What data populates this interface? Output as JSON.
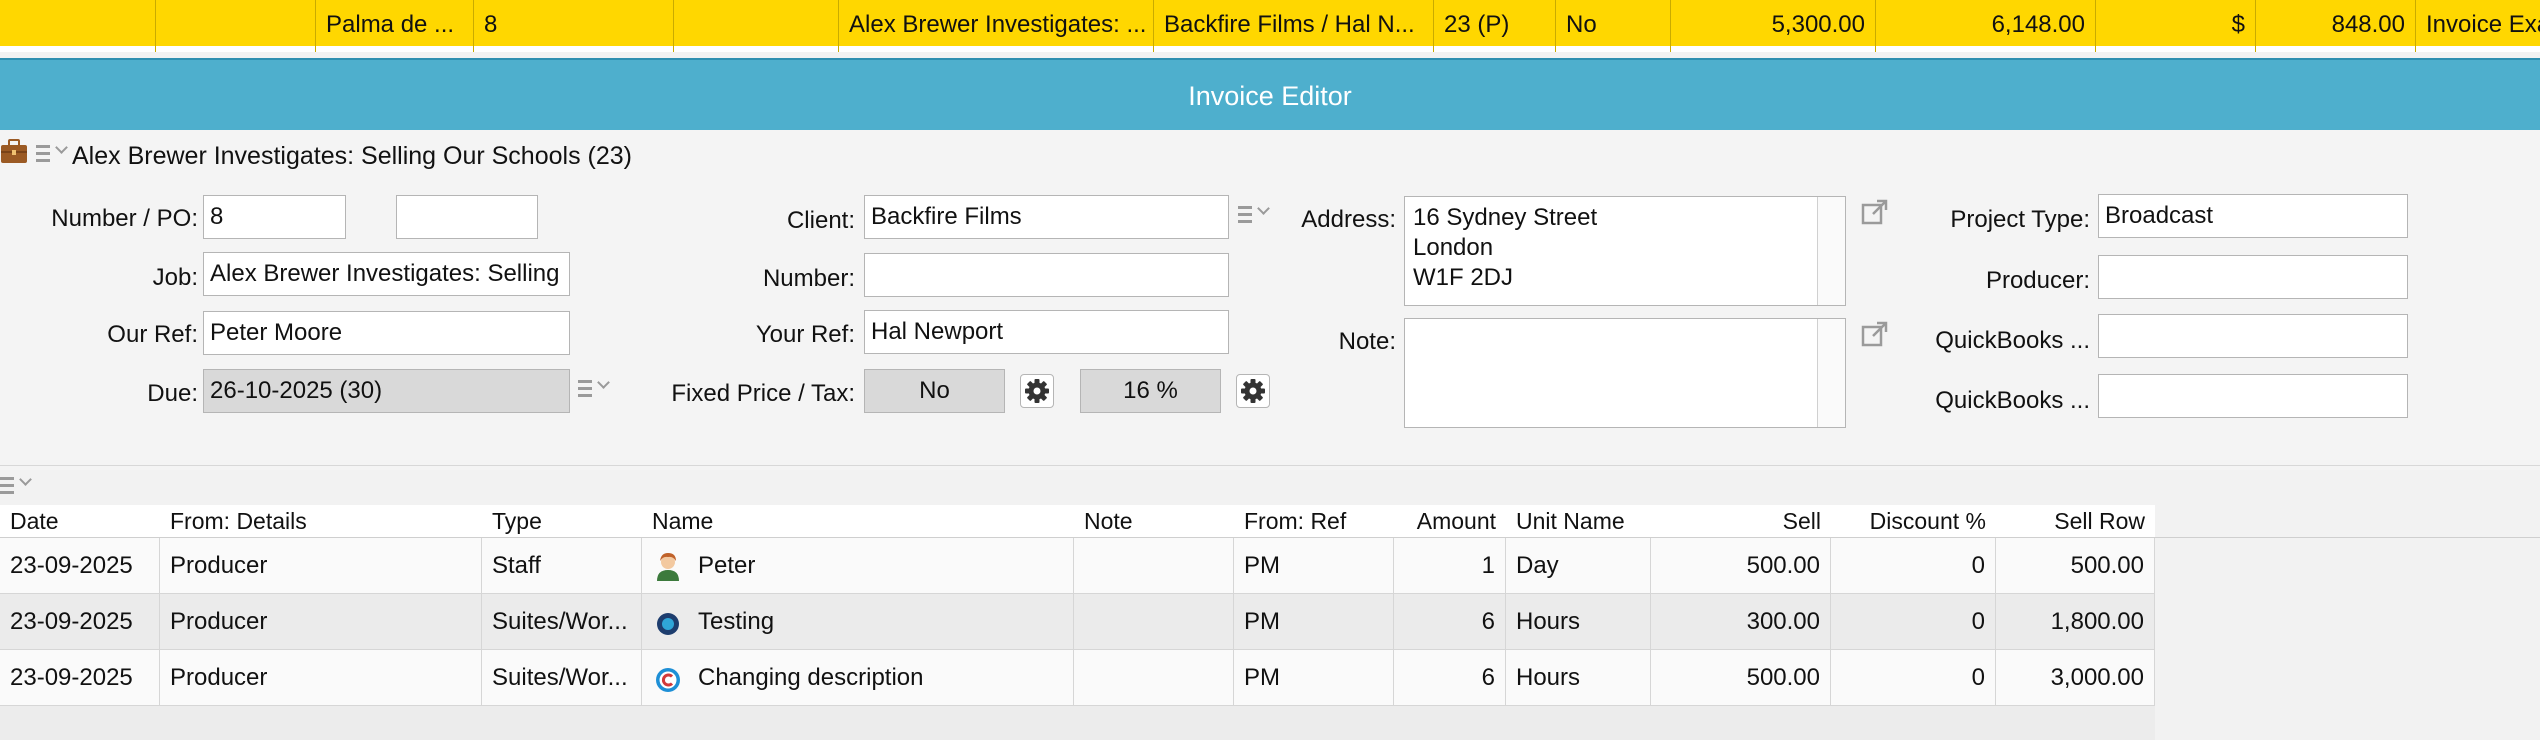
{
  "top_row": {
    "cells": [
      {
        "text": ""
      },
      {
        "text": ""
      },
      {
        "text": "Palma de ..."
      },
      {
        "text": "8"
      },
      {
        "text": ""
      },
      {
        "text": "Alex Brewer Investigates: ..."
      },
      {
        "text": "Backfire Films / Hal N..."
      },
      {
        "text": "23 (P)"
      },
      {
        "text": "No"
      },
      {
        "text": "5,300.00"
      },
      {
        "text": "6,148.00"
      },
      {
        "text": "$"
      },
      {
        "text": "848.00"
      },
      {
        "text": "Invoice Exa"
      }
    ]
  },
  "window": {
    "title": "Invoice Editor"
  },
  "job_header": {
    "title": "Alex Brewer Investigates: Selling Our Schools (23)"
  },
  "form": {
    "number_po_label": "Number / PO:",
    "number_value": "8",
    "po_value": "",
    "job_label": "Job:",
    "job_value": "Alex Brewer Investigates: Selling",
    "our_ref_label": "Our Ref:",
    "our_ref_value": "Peter Moore",
    "due_label": "Due:",
    "due_value": "26-10-2025 (30)",
    "client_label": "Client:",
    "client_value": "Backfire Films",
    "number_label": "Number:",
    "number2_value": "",
    "your_ref_label": "Your Ref:",
    "your_ref_value": "Hal Newport",
    "fixed_price_tax_label": "Fixed Price / Tax:",
    "fixed_price_value": "No",
    "tax_value": "16 %",
    "address_label": "Address:",
    "address_line1": "16 Sydney Street",
    "address_line2": "London",
    "address_line3": "W1F 2DJ",
    "note_label": "Note:",
    "note_value": "",
    "project_type_label": "Project Type:",
    "project_type_value": "Broadcast",
    "producer_label": "Producer:",
    "producer_value": "",
    "quickbooks1_label": "QuickBooks ...",
    "quickbooks1_value": "",
    "quickbooks2_label": "QuickBooks ...",
    "quickbooks2_value": ""
  },
  "grid": {
    "columns": [
      "Date",
      "From: Details",
      "Type",
      "Name",
      "Note",
      "From: Ref",
      "Amount",
      "Unit Name",
      "Sell",
      "Discount %",
      "Sell Row"
    ],
    "rows": [
      {
        "date": "23-09-2025",
        "from_details": "Producer",
        "type": "Staff",
        "icon": "person-avatar-icon",
        "name": "Peter",
        "note": "",
        "from_ref": "PM",
        "amount": "1",
        "unit": "Day",
        "sell": "500.00",
        "discount": "0",
        "sell_row": "500.00"
      },
      {
        "date": "23-09-2025",
        "from_details": "Producer",
        "type": "Suites/Wor...",
        "icon": "suite-logo-icon",
        "name": "Testing",
        "note": "",
        "from_ref": "PM",
        "amount": "6",
        "unit": "Hours",
        "sell": "300.00",
        "discount": "0",
        "sell_row": "1,800.00"
      },
      {
        "date": "23-09-2025",
        "from_details": "Producer",
        "type": "Suites/Wor...",
        "icon": "copyright-logo-icon",
        "name": "Changing description",
        "note": "",
        "from_ref": "PM",
        "amount": "6",
        "unit": "Hours",
        "sell": "500.00",
        "discount": "0",
        "sell_row": "3,000.00"
      }
    ]
  },
  "colors": {
    "top_row_bg": "#ffd700",
    "titlebar_bg": "#4eafcd"
  }
}
